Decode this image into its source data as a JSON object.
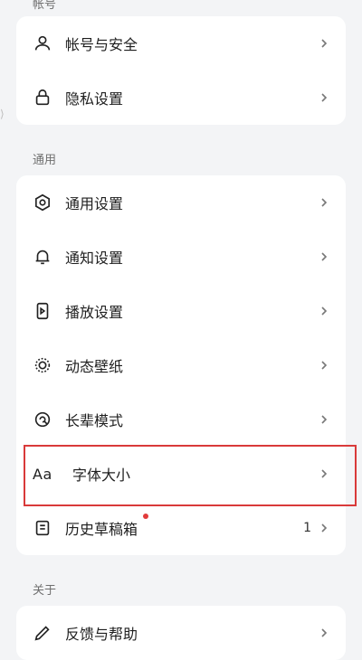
{
  "sections": {
    "account": {
      "title": "帐号",
      "items": [
        {
          "label": "帐号与安全"
        },
        {
          "label": "隐私设置"
        }
      ]
    },
    "general": {
      "title": "通用",
      "items": [
        {
          "label": "通用设置"
        },
        {
          "label": "通知设置"
        },
        {
          "label": "播放设置"
        },
        {
          "label": "动态壁纸"
        },
        {
          "label": "长辈模式"
        },
        {
          "label": "字体大小",
          "icon_text": "Aa"
        },
        {
          "label": "历史草稿箱",
          "count": "1"
        }
      ]
    },
    "about": {
      "title": "关于",
      "items": [
        {
          "label": "反馈与帮助"
        }
      ]
    }
  },
  "colors": {
    "background": "#f3f4f6",
    "card": "#ffffff",
    "highlight_border": "#d93a3a",
    "notification_dot": "#e23b3b"
  }
}
